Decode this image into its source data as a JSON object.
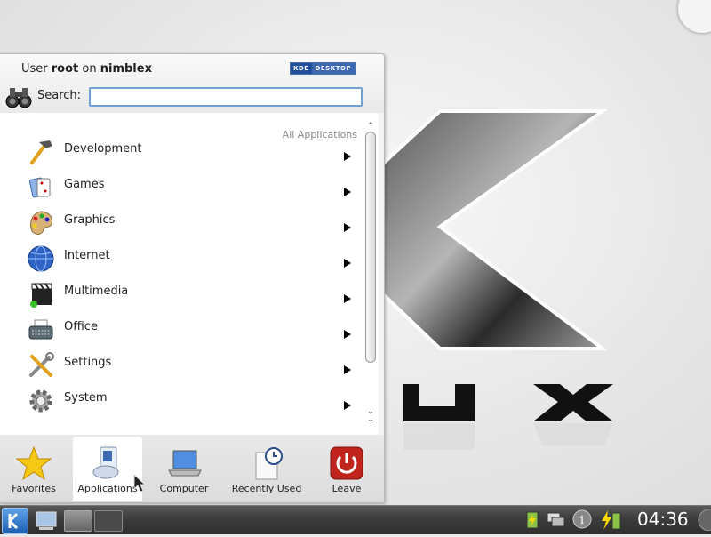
{
  "launcher": {
    "user_prefix": "User ",
    "username": "root",
    "on_text": " on ",
    "hostname": "nimblex",
    "badge": {
      "left": "KDE",
      "right": "DESKTOP"
    },
    "search_label": "Search:",
    "search_value": "",
    "breadcrumb": "All Applications",
    "categories": [
      {
        "label": "Development",
        "icon": "hammer-icon"
      },
      {
        "label": "Games",
        "icon": "playing-cards-icon"
      },
      {
        "label": "Graphics",
        "icon": "paint-palette-icon"
      },
      {
        "label": "Internet",
        "icon": "globe-icon"
      },
      {
        "label": "Multimedia",
        "icon": "clapperboard-icon"
      },
      {
        "label": "Office",
        "icon": "typewriter-icon"
      },
      {
        "label": "Settings",
        "icon": "tools-icon"
      },
      {
        "label": "System",
        "icon": "gear-icon"
      }
    ],
    "tabs": [
      {
        "label": "Favorites",
        "icon": "star-icon"
      },
      {
        "label": "Applications",
        "icon": "applications-icon",
        "active": true
      },
      {
        "label": "Computer",
        "icon": "laptop-icon"
      },
      {
        "label": "Recently Used",
        "icon": "clock-document-icon"
      },
      {
        "label": "Leave",
        "icon": "power-icon"
      }
    ]
  },
  "panel": {
    "clock": "04:36",
    "tray_icons": [
      "battery-charging-icon",
      "network-icon",
      "info-icon",
      "power-manager-icon"
    ]
  },
  "colors": {
    "accent": "#3d6ab2",
    "search_border": "#6fa1d6",
    "leave_red": "#c0241c",
    "panel_dark": "#3c3c3c"
  }
}
